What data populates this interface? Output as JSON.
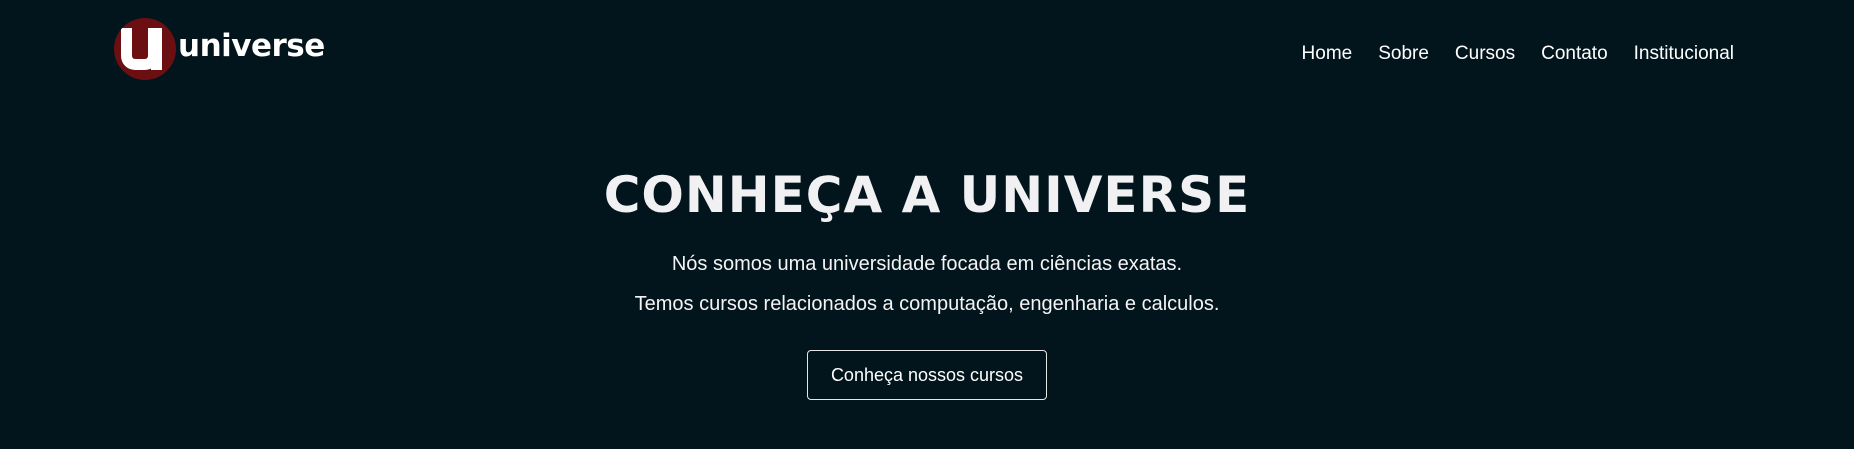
{
  "brand": {
    "name": "universe",
    "accent_color": "#6b0f12",
    "background_color": "#03151c"
  },
  "nav": {
    "items": [
      {
        "label": "Home"
      },
      {
        "label": "Sobre"
      },
      {
        "label": "Cursos"
      },
      {
        "label": "Contato"
      },
      {
        "label": "Institucional"
      }
    ]
  },
  "hero": {
    "title": "CONHEÇA A UNIVERSE",
    "line1": "Nós somos uma universidade focada em ciências exatas.",
    "line2": "Temos cursos relacionados a computação, engenharia e calculos.",
    "cta_label": "Conheça nossos cursos"
  }
}
